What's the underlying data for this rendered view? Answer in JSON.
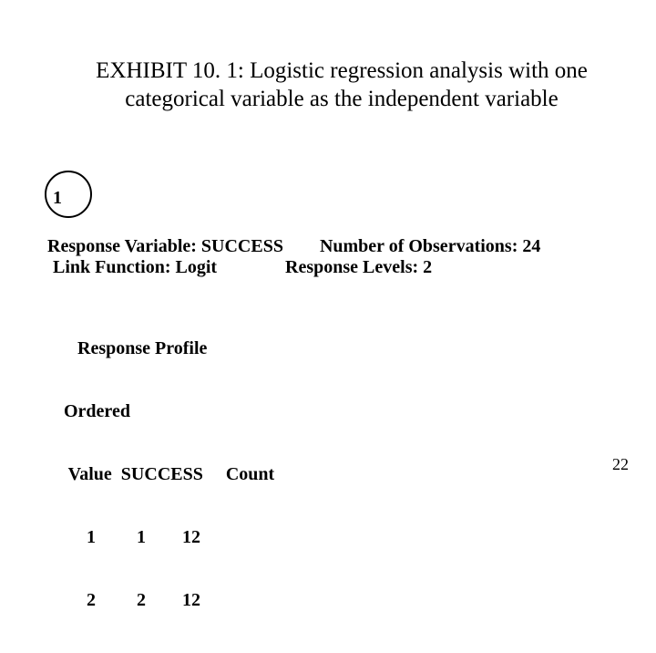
{
  "title": "EXHIBIT 10. 1: Logistic regression analysis with one categorical variable as the independent variable",
  "callout_number": "1",
  "meta": {
    "line1": "Response Variable: SUCCESS        Number of Observations: 24",
    "line2": "Link Function: Logit               Response Levels: 2"
  },
  "response_profile": {
    "header": "   Response Profile",
    "col_line1": "Ordered",
    "col_line2": " Value  SUCCESS     Count",
    "rows": [
      "     1         1        12",
      "     2         2        12"
    ]
  },
  "page_number": "22"
}
